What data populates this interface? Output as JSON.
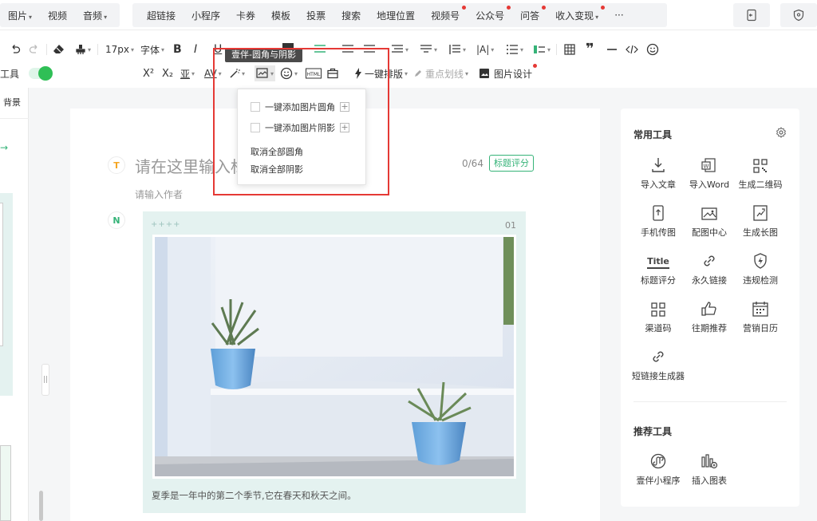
{
  "topnav": {
    "group1": [
      {
        "label": "图片",
        "caret": true
      },
      {
        "label": "视频",
        "caret": false
      },
      {
        "label": "音频",
        "caret": true
      }
    ],
    "group2": [
      {
        "label": "超链接",
        "dot": false,
        "caret": false
      },
      {
        "label": "小程序",
        "dot": false,
        "caret": false
      },
      {
        "label": "卡券",
        "dot": false,
        "caret": false
      },
      {
        "label": "模板",
        "dot": false,
        "caret": false
      },
      {
        "label": "投票",
        "dot": false,
        "caret": false
      },
      {
        "label": "搜索",
        "dot": false,
        "caret": false
      },
      {
        "label": "地理位置",
        "dot": false,
        "caret": false
      },
      {
        "label": "视频号",
        "dot": true,
        "caret": false
      },
      {
        "label": "公众号",
        "dot": true,
        "caret": false
      },
      {
        "label": "问答",
        "dot": true,
        "caret": false
      },
      {
        "label": "收入变现",
        "dot": true,
        "caret": true
      },
      {
        "label": "···",
        "dot": false,
        "caret": false
      }
    ]
  },
  "toolbar": {
    "font_size": "17px",
    "font_family": "字体",
    "one_click_format": "一键排版",
    "highlight": "重点划线",
    "image_design": "图片设计",
    "left_tools_label": "工具",
    "tooltip": "壹伴-圆角与阴影"
  },
  "dropdown": {
    "items": [
      "一键添加图片圆角",
      "一键添加图片阴影"
    ],
    "actions": [
      "取消全部圆角",
      "取消全部阴影"
    ]
  },
  "left": {
    "tab_label": "背景"
  },
  "editor": {
    "title_placeholder": "请在这里输入标",
    "counter": "0/64",
    "score_button": "标题评分",
    "author_placeholder": "请输入作者",
    "card_decor": "++++",
    "card_index": "01",
    "caption": "夏季是一年中的第二个季节,它在春天和秋天之间。"
  },
  "panel": {
    "common_title": "常用工具",
    "tools": [
      {
        "label": "导入文章",
        "icon": "import-icon"
      },
      {
        "label": "导入Word",
        "icon": "word-icon"
      },
      {
        "label": "生成二维码",
        "icon": "qrcode-icon"
      },
      {
        "label": "手机传图",
        "icon": "phone-upload-icon"
      },
      {
        "label": "配图中心",
        "icon": "image-center-icon"
      },
      {
        "label": "生成长图",
        "icon": "long-image-icon"
      },
      {
        "label": "标题评分",
        "icon": "title-score-icon",
        "icon_text": "Title"
      },
      {
        "label": "永久链接",
        "icon": "link-icon"
      },
      {
        "label": "违规检测",
        "icon": "violation-check-icon"
      },
      {
        "label": "渠道码",
        "icon": "channel-code-icon"
      },
      {
        "label": "往期推荐",
        "icon": "thumb-up-icon"
      },
      {
        "label": "营销日历",
        "icon": "calendar-icon"
      },
      {
        "label": "短链接生成器",
        "icon": "short-link-icon"
      }
    ],
    "recommend_title": "推荐工具",
    "recommend": [
      {
        "label": "壹伴小程序",
        "icon": "miniprogram-icon"
      },
      {
        "label": "插入图表",
        "icon": "insert-chart-icon"
      }
    ]
  },
  "colors": {
    "accent": "#35b378",
    "red": "#e53935",
    "card_bg": "#e4f2f0"
  }
}
